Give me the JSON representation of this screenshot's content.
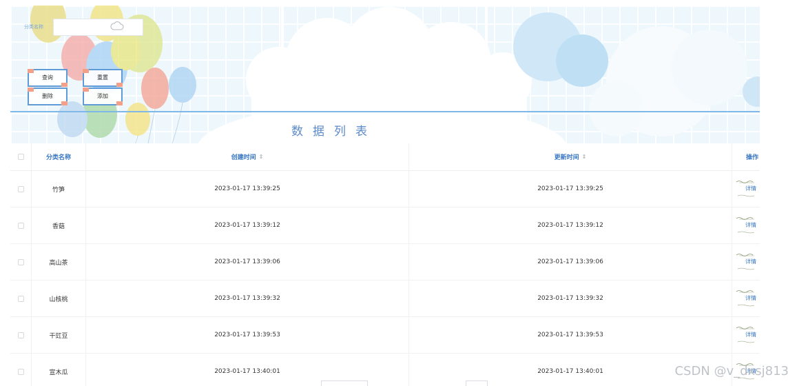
{
  "search": {
    "label": "分类名称",
    "value": "",
    "placeholder": ""
  },
  "buttons": {
    "query": "查询",
    "reset": "重置",
    "delete": "删除",
    "add": "添加"
  },
  "list_title": "数据列表",
  "table": {
    "columns": {
      "name": "分类名称",
      "created": "创建时间",
      "updated": "更新时间",
      "actions": "操作"
    },
    "sort_glyph": "⇕",
    "detail_label": "详情",
    "rows": [
      {
        "name": "竹笋",
        "created": "2023-01-17 13:39:25",
        "updated": "2023-01-17 13:39:25"
      },
      {
        "name": "香菇",
        "created": "2023-01-17 13:39:12",
        "updated": "2023-01-17 13:39:12"
      },
      {
        "name": "高山茶",
        "created": "2023-01-17 13:39:06",
        "updated": "2023-01-17 13:39:06"
      },
      {
        "name": "山核桃",
        "created": "2023-01-17 13:39:32",
        "updated": "2023-01-17 13:39:32"
      },
      {
        "name": "干豇豆",
        "created": "2023-01-17 13:39:53",
        "updated": "2023-01-17 13:39:53"
      },
      {
        "name": "宣木瓜",
        "created": "2023-01-17 13:40:01",
        "updated": "2023-01-17 13:40:01"
      }
    ]
  },
  "watermark": "CSDN @v_dxsj813",
  "colors": {
    "accent": "#3a78c4",
    "title_blue": "#5b8ac9",
    "banner_bg": "#eef7fc",
    "button_border": "#5d9ad6"
  },
  "icons": {
    "search_field": "cloud-icon",
    "sort": "sort-icon",
    "checkbox": "checkbox-icon"
  }
}
